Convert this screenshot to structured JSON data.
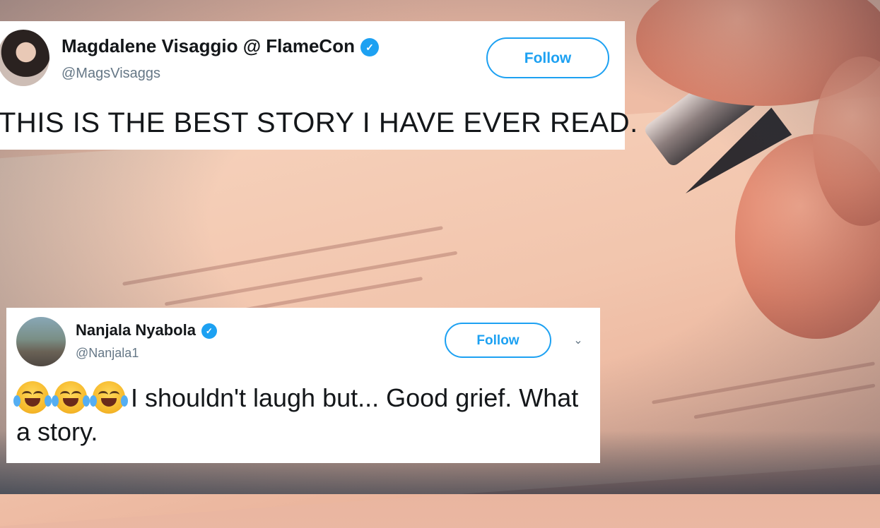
{
  "tweets": [
    {
      "name": "Magdalene Visaggio @ FlameCon",
      "handle": "@MagsVisaggs",
      "follow_label": "Follow",
      "text": "THIS IS THE BEST STORY I HAVE EVER READ."
    },
    {
      "name": "Nanjala Nyabola",
      "handle": "@Nanjala1",
      "follow_label": "Follow",
      "text": "I shouldn't laugh but... Good grief. What a story.",
      "emoji_count": 3,
      "emoji": "face-with-tears-of-joy"
    }
  ],
  "verified_color": "#1da1f2"
}
